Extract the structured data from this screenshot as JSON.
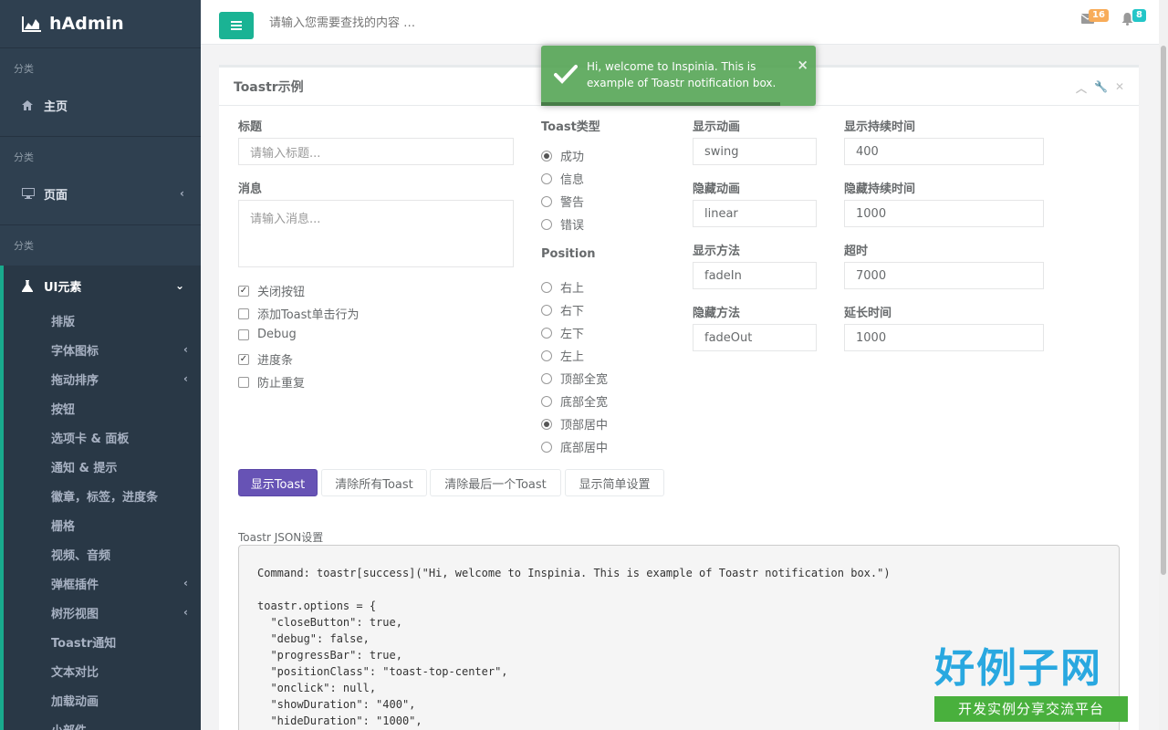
{
  "sidebar": {
    "brand": "hAdmin",
    "cat1": "分类",
    "home": "主页",
    "cat2": "分类",
    "pages": "页面",
    "cat3": "分类",
    "ui": "UI元素",
    "sub": [
      {
        "label": "排版",
        "chevron": false
      },
      {
        "label": "字体图标",
        "chevron": true
      },
      {
        "label": "拖动排序",
        "chevron": true
      },
      {
        "label": "按钮",
        "chevron": false
      },
      {
        "label": "选项卡 & 面板",
        "chevron": false
      },
      {
        "label": "通知 & 提示",
        "chevron": false
      },
      {
        "label": "徽章，标签，进度条",
        "chevron": false
      },
      {
        "label": "栅格",
        "chevron": false
      },
      {
        "label": "视频、音频",
        "chevron": false
      },
      {
        "label": "弹框插件",
        "chevron": true
      },
      {
        "label": "树形视图",
        "chevron": true
      },
      {
        "label": "Toastr通知",
        "chevron": false
      },
      {
        "label": "文本对比",
        "chevron": false
      },
      {
        "label": "加载动画",
        "chevron": false
      },
      {
        "label": "小部件",
        "chevron": false
      }
    ]
  },
  "topbar": {
    "search_placeholder": "请输入您需要查找的内容 …",
    "mail_count": "16",
    "bell_count": "8"
  },
  "panel": {
    "title": "Toastr示例",
    "title_label": "标题",
    "title_placeholder": "请输入标题...",
    "message_label": "消息",
    "message_placeholder": "请输入消息...",
    "checks": [
      {
        "label": "关闭按钮",
        "checked": true
      },
      {
        "label": "添加Toast单击行为",
        "checked": false
      },
      {
        "label": "Debug",
        "checked": false
      },
      {
        "label": "进度条",
        "checked": true
      },
      {
        "label": "防止重复",
        "checked": false
      }
    ],
    "type_label": "Toast类型",
    "types": [
      {
        "label": "成功",
        "selected": true
      },
      {
        "label": "信息",
        "selected": false
      },
      {
        "label": "警告",
        "selected": false
      },
      {
        "label": "错误",
        "selected": false
      }
    ],
    "position_label": "Position",
    "positions": [
      {
        "label": "右上",
        "selected": false
      },
      {
        "label": "右下",
        "selected": false
      },
      {
        "label": "左下",
        "selected": false
      },
      {
        "label": "左上",
        "selected": false
      },
      {
        "label": "顶部全宽",
        "selected": false
      },
      {
        "label": "底部全宽",
        "selected": false
      },
      {
        "label": "顶部居中",
        "selected": true
      },
      {
        "label": "底部居中",
        "selected": false
      }
    ],
    "show_easing_label": "显示动画",
    "show_easing": "swing",
    "hide_easing_label": "隐藏动画",
    "hide_easing": "linear",
    "show_method_label": "显示方法",
    "show_method": "fadeIn",
    "hide_method_label": "隐藏方法",
    "hide_method": "fadeOut",
    "show_duration_label": "显示持续时间",
    "show_duration": "400",
    "hide_duration_label": "隐藏持续时间",
    "hide_duration": "1000",
    "timeout_label": "超时",
    "timeout": "7000",
    "ext_timeout_label": "延长时间",
    "ext_timeout": "1000",
    "buttons": {
      "show": "显示Toast",
      "clear_all": "清除所有Toast",
      "clear_last": "清除最后一个Toast",
      "simple": "显示简单设置"
    },
    "json_label": "Toastr JSON设置",
    "json_text": "Command: toastr[success](\"Hi, welcome to Inspinia. This is example of Toastr notification box.\")\n\ntoastr.options = {\n  \"closeButton\": true,\n  \"debug\": false,\n  \"progressBar\": true,\n  \"positionClass\": \"toast-top-center\",\n  \"onclick\": null,\n  \"showDuration\": \"400\",\n  \"hideDuration\": \"1000\","
  },
  "toast": {
    "message": "Hi, welcome to Inspinia. This is example of Toastr notification box.",
    "close": "×",
    "progress": 0.87
  },
  "watermark": {
    "main": "好例子网",
    "sub": "开发实例分享交流平台"
  },
  "colors": {
    "sidebar": "#2f4050",
    "accent": "#1ab394",
    "primary_button": "#6753b5",
    "toast_success": "#51a351",
    "badge_mail": "#f8ac59",
    "badge_bell": "#23c6c8"
  }
}
